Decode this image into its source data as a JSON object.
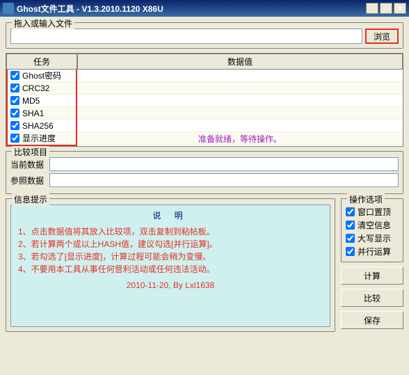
{
  "title": "Ghost文件工具 - V1.3.2010.1120 X86U",
  "fileGroup": {
    "label": "拖入或输入文件",
    "browse": "浏览"
  },
  "taskTable": {
    "headers": {
      "task": "任务",
      "value": "数据值"
    },
    "rows": [
      {
        "label": "Ghost密码"
      },
      {
        "label": "CRC32"
      },
      {
        "label": "MD5"
      },
      {
        "label": "SHA1"
      },
      {
        "label": "SHA256"
      },
      {
        "label": "显示进度"
      }
    ],
    "status": "准备就绪，等待操作。"
  },
  "compare": {
    "label": "比较项目",
    "current": "当前数据",
    "ref": "参照数据"
  },
  "info": {
    "label": "信息提示",
    "title": "说 明",
    "lines": [
      "1、点击数据值将其放入比较项，双击复制到粘帖板。",
      "2、若计算两个或以上HASH值，建议勾选[并行运算]。",
      "3、若勾选了[显示进度]，计算过程可能会稍为变慢。",
      "4、不要用本工具从事任何营利活动或任何违法活动。"
    ],
    "date": "2010-11-20, By Lxl1638"
  },
  "options": {
    "label": "操作选项",
    "items": [
      "窗口置顶",
      "清空信息",
      "大写显示",
      "并行运算"
    ]
  },
  "buttons": {
    "calc": "计算",
    "compare": "比较",
    "save": "保存"
  }
}
